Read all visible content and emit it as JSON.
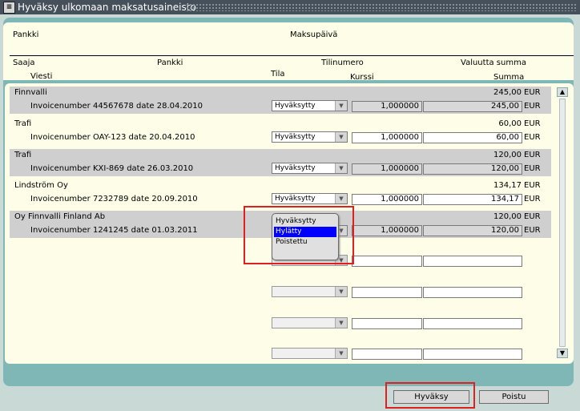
{
  "window": {
    "title": "Hyväksy ulkomaan maksatusaineisto"
  },
  "header": {
    "pankki": "Pankki",
    "maksupaiva": "Maksupäivä",
    "saaja": "Saaja",
    "pankki2": "Pankki",
    "tilinumero": "Tilinumero",
    "valuutta_summa": "Valuutta summa",
    "viesti": "Viesti",
    "tila": "Tila",
    "kurssi": "Kurssi",
    "summa": "Summa"
  },
  "rows": [
    {
      "payee": "Finnvalli",
      "message": "Invoicenumber 44567678 date 28.04.2010",
      "currency_amount": "245,00",
      "currency": "EUR",
      "status": "Hyväksytty",
      "rate": "1,000000",
      "amount": "245,00",
      "amount_currency": "EUR"
    },
    {
      "payee": "Trafi",
      "message": "Invoicenumber OAY-123 date 20.04.2010",
      "currency_amount": "60,00",
      "currency": "EUR",
      "status": "Hyväksytty",
      "rate": "1,000000",
      "amount": "60,00",
      "amount_currency": "EUR"
    },
    {
      "payee": "Trafi",
      "message": "Invoicenumber KXI-869 date 26.03.2010",
      "currency_amount": "120,00",
      "currency": "EUR",
      "status": "Hyväksytty",
      "rate": "1,000000",
      "amount": "120,00",
      "amount_currency": "EUR"
    },
    {
      "payee": "Lindström Oy",
      "message": "Invoicenumber 7232789 date 20.09.2010",
      "currency_amount": "134,17",
      "currency": "EUR",
      "status": "Hyväksytty",
      "rate": "1,000000",
      "amount": "134,17",
      "amount_currency": "EUR"
    },
    {
      "payee": "Oy Finnvalli Finland Ab",
      "message": "Invoicenumber 1241245 date 01.03.2011",
      "currency_amount": "120,00",
      "currency": "EUR",
      "status": "",
      "rate": "1,000000",
      "amount": "120,00",
      "amount_currency": "EUR"
    }
  ],
  "status_dropdown": {
    "options": [
      "Hyväksytty",
      "Hylätty",
      "Poistettu"
    ],
    "highlighted": "Hylätty"
  },
  "buttons": {
    "approve": "Hyväksy",
    "exit": "Poistu"
  },
  "colors": {
    "panel": "#7fb7b6",
    "content_bg": "#fdfde8",
    "row_highlight": "#cfcfcf",
    "selection": "#0000ff",
    "annotation": "#e02020"
  }
}
